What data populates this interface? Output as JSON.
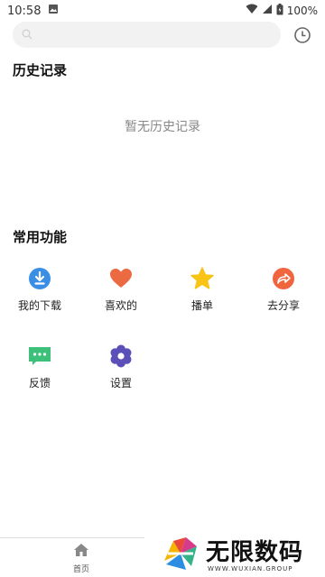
{
  "status_bar": {
    "time": "10:58",
    "battery": "100%"
  },
  "search": {
    "placeholder": ""
  },
  "history": {
    "title": "历史记录",
    "empty_text": "暂无历史记录"
  },
  "features": {
    "title": "常用功能",
    "items": [
      {
        "label": "我的下载",
        "icon": "download-icon",
        "color": "#3a8ee6"
      },
      {
        "label": "喜欢的",
        "icon": "heart-icon",
        "color": "#ec6a42"
      },
      {
        "label": "播单",
        "icon": "star-icon",
        "color": "#f8c415"
      },
      {
        "label": "去分享",
        "icon": "share-icon",
        "color": "#f0643e"
      },
      {
        "label": "反馈",
        "icon": "feedback-icon",
        "color": "#3cc07a"
      },
      {
        "label": "设置",
        "icon": "settings-icon",
        "color": "#5b4fb8"
      }
    ]
  },
  "bottom_nav": {
    "home_label": "首页"
  },
  "watermark": {
    "text": "无限数码",
    "sub": "WWW.WUXIAN.GROUP"
  }
}
